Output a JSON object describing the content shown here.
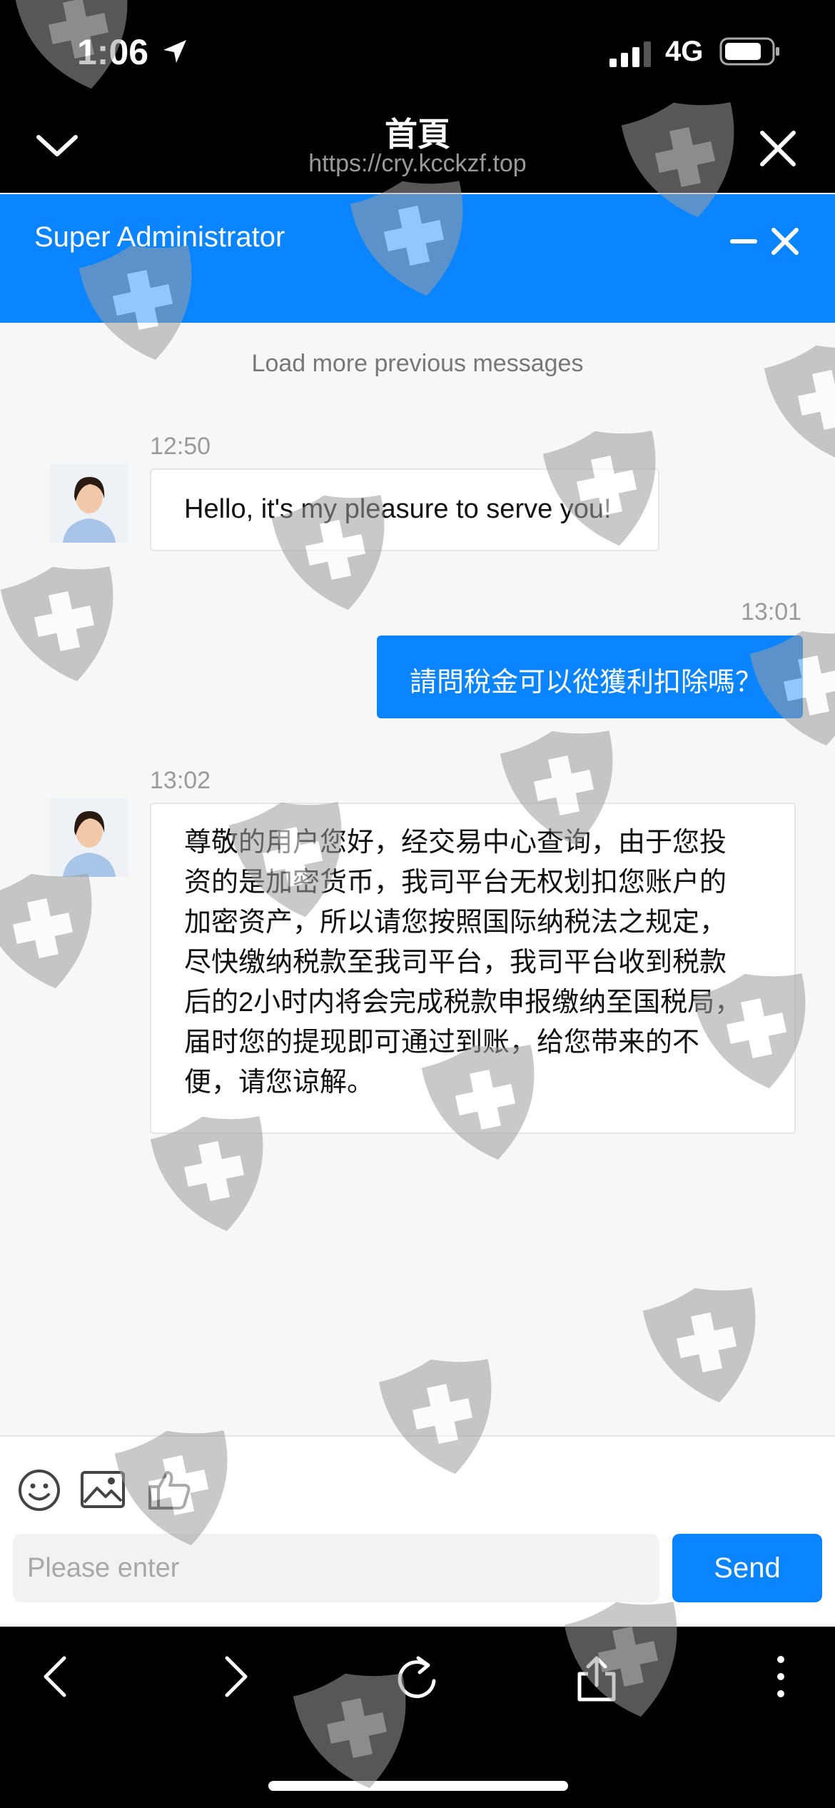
{
  "status_bar": {
    "time": "1:06",
    "network": "4G"
  },
  "browser": {
    "title": "首頁",
    "url": "https://cry.kcckzf.top"
  },
  "chat": {
    "header_title": "Super Administrator",
    "load_more": "Load more previous messages",
    "messages": [
      {
        "time": "12:50",
        "direction": "incoming",
        "text": "Hello, it's my pleasure to serve you!"
      },
      {
        "time": "13:01",
        "direction": "outgoing",
        "text": "請問稅金可以從獲利扣除嗎？"
      },
      {
        "time": "13:02",
        "direction": "incoming",
        "lines": [
          "尊敬的用户您好，经交易中心查询，由于您投",
          "资的是加密货币，我司平台无权划扣您账户的",
          "加密资产，所以请您按照国际纳税法之规定，",
          "尽快缴纳税款至我司平台，我司平台收到税款",
          "后的2小时内将会完成税款申报缴纳至国税局，",
          "届时您的提现即可通过到账，给您带来的不",
          "便，请您谅解。"
        ]
      }
    ]
  },
  "composer": {
    "placeholder": "Please enter",
    "send_label": "Send"
  },
  "colors": {
    "accent": "#0a84ff",
    "watermark": "#9e9e9e"
  }
}
